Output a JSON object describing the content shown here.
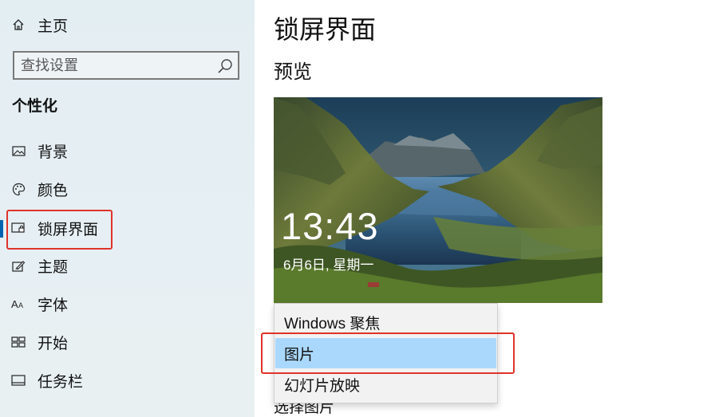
{
  "sidebar": {
    "home_label": "主页",
    "search_placeholder": "查找设置",
    "section_title": "个性化",
    "items": [
      {
        "label": "背景",
        "icon": "image-icon"
      },
      {
        "label": "颜色",
        "icon": "palette-icon"
      },
      {
        "label": "锁屏界面",
        "icon": "lock-screen-icon",
        "active": true
      },
      {
        "label": "主题",
        "icon": "theme-brush-icon"
      },
      {
        "label": "字体",
        "icon": "font-icon"
      },
      {
        "label": "开始",
        "icon": "start-grid-icon"
      },
      {
        "label": "任务栏",
        "icon": "taskbar-icon"
      }
    ]
  },
  "main": {
    "title": "锁屏界面",
    "preview_heading": "预览",
    "preview": {
      "time": "13:43",
      "date": "6月6日, 星期一"
    },
    "dropdown_options": [
      {
        "label": "Windows 聚焦"
      },
      {
        "label": "图片",
        "selected": true
      },
      {
        "label": "幻灯片放映"
      }
    ],
    "below_partial_text": "选择图片"
  },
  "colors": {
    "accent": "#0063b1",
    "highlight": "#e0332b",
    "selected_option": "#aad8fc"
  }
}
